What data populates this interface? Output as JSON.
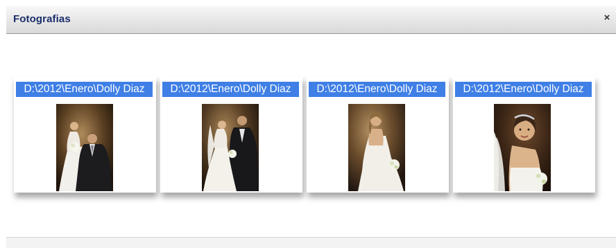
{
  "dialog": {
    "title": "Fotografias",
    "close_label": "×"
  },
  "photos": [
    {
      "label": "D:\\2012\\Enero\\Dolly Diaz"
    },
    {
      "label": "D:\\2012\\Enero\\Dolly Diaz"
    },
    {
      "label": "D:\\2012\\Enero\\Dolly Diaz"
    },
    {
      "label": "D:\\2012\\Enero\\Dolly Diaz"
    }
  ],
  "colors": {
    "title_text": "#1d2f6b",
    "label_background": "#3f7fe6",
    "label_text": "#ffffff"
  }
}
